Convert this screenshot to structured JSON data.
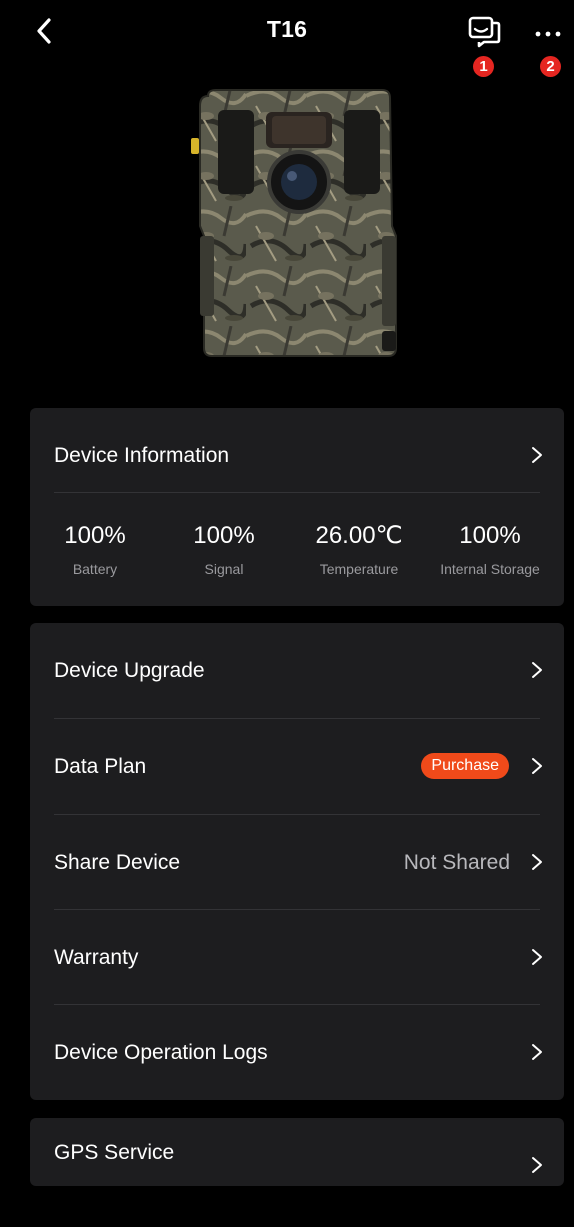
{
  "header": {
    "title": "T16",
    "badges": [
      "1",
      "2"
    ]
  },
  "device_info": {
    "label": "Device Information",
    "stats": [
      {
        "value": "100%",
        "label": "Battery"
      },
      {
        "value": "100%",
        "label": "Signal"
      },
      {
        "value": "26.00℃",
        "label": "Temperature"
      },
      {
        "value": "100%",
        "label": "Internal Storage"
      }
    ]
  },
  "menu": {
    "device_upgrade": "Device Upgrade",
    "data_plan": "Data Plan",
    "purchase_badge": "Purchase",
    "share_device": "Share Device",
    "share_status": "Not Shared",
    "warranty": "Warranty",
    "operation_logs": "Device Operation Logs"
  },
  "gps": {
    "label": "GPS Service"
  },
  "colors": {
    "background": "#000000",
    "card": "#1d1d1f",
    "badge_red": "#e52621",
    "purchase_orange": "#f04a1a",
    "muted_text": "#9a9a9e"
  },
  "icons": [
    "back-arrow-icon",
    "message-icon",
    "more-icon",
    "chevron-right-icon"
  ]
}
